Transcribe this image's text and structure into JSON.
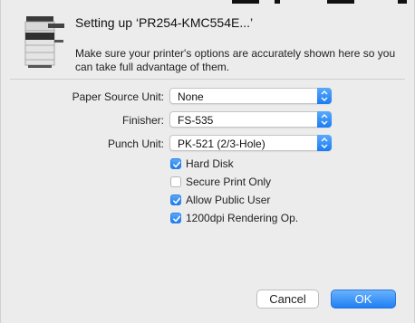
{
  "dialog": {
    "title": "Setting up ‘PR254-KMC554E...’",
    "description": "Make sure your printer's options are accurately shown here so you can take full advantage of them."
  },
  "options": {
    "paper_source": {
      "label": "Paper Source Unit:",
      "value": "None"
    },
    "finisher": {
      "label": "Finisher:",
      "value": "FS-535"
    },
    "punch_unit": {
      "label": "Punch Unit:",
      "value": "PK-521 (2/3-Hole)"
    }
  },
  "checkboxes": [
    {
      "label": "Hard Disk",
      "checked": true
    },
    {
      "label": "Secure Print Only",
      "checked": false
    },
    {
      "label": "Allow Public User",
      "checked": true
    },
    {
      "label": "1200dpi Rendering Op.",
      "checked": true
    }
  ],
  "buttons": {
    "cancel": "Cancel",
    "ok": "OK"
  },
  "colors": {
    "accent": "#1b7cf3",
    "background": "#ececec"
  },
  "icons": {
    "printer": "printer-icon",
    "popup_arrows": "up-down-arrows-icon",
    "checkmark": "checkmark-icon"
  }
}
